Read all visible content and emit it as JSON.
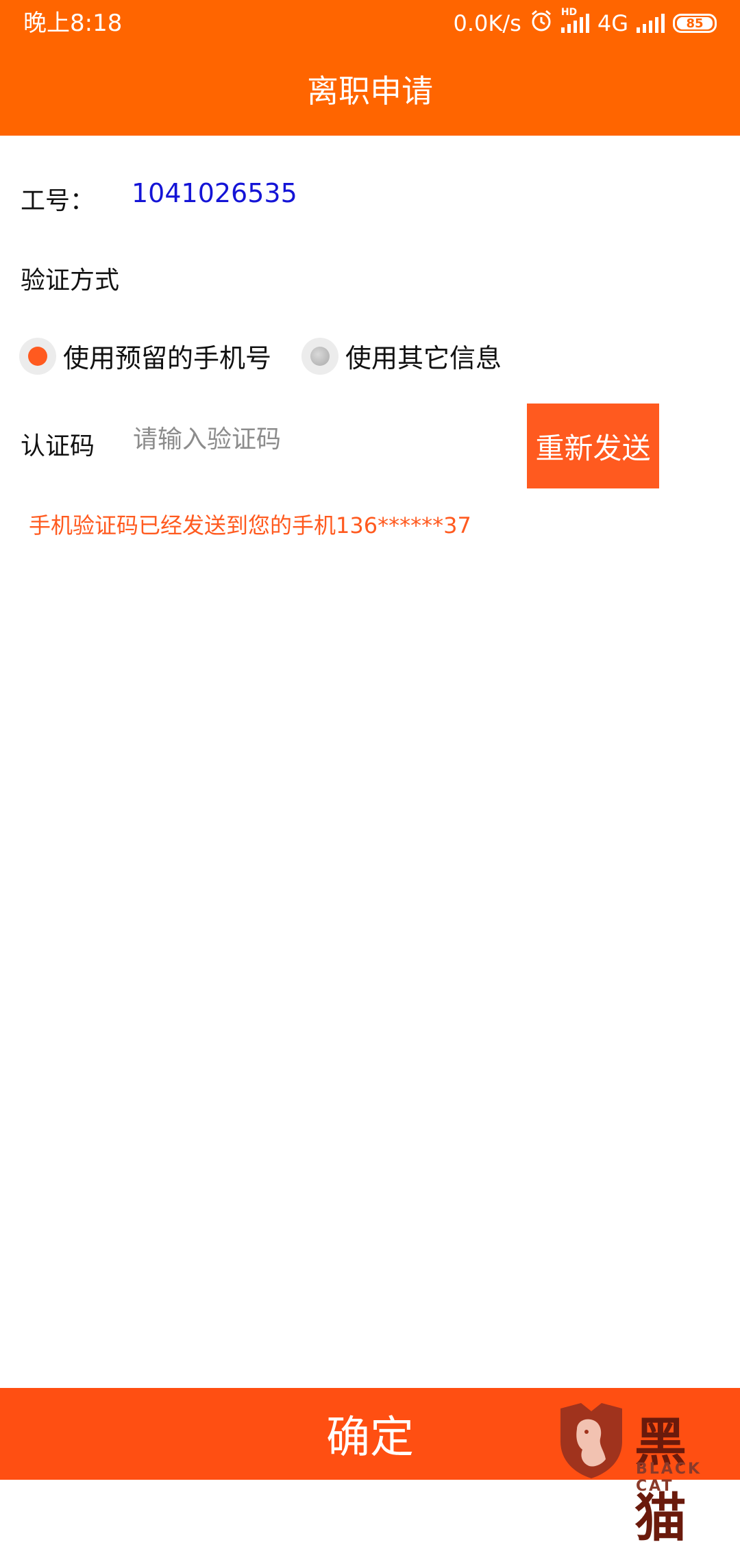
{
  "status_bar": {
    "time": "晚上8:18",
    "net_speed": "0.0K/s",
    "hd_label": "HD",
    "network": "4G",
    "battery": "85"
  },
  "title": "离职申请",
  "employee": {
    "label": "工号：",
    "value": "1041026535"
  },
  "verify": {
    "label": "验证方式",
    "options": [
      {
        "label": "使用预留的手机号",
        "selected": true
      },
      {
        "label": "使用其它信息",
        "selected": false
      }
    ]
  },
  "code": {
    "label": "认证码",
    "placeholder": "请输入验证码",
    "value": "",
    "resend_label": "重新发送"
  },
  "sent_message": "手机验证码已经发送到您的手机136******37",
  "confirm_label": "确定",
  "watermark": {
    "text": "黑猫",
    "sub": "BLACK CAT"
  },
  "colors": {
    "header": "#ff6500",
    "accent": "#ff5a1f",
    "confirm": "#ff4f12",
    "employee_value": "#1414d6"
  }
}
